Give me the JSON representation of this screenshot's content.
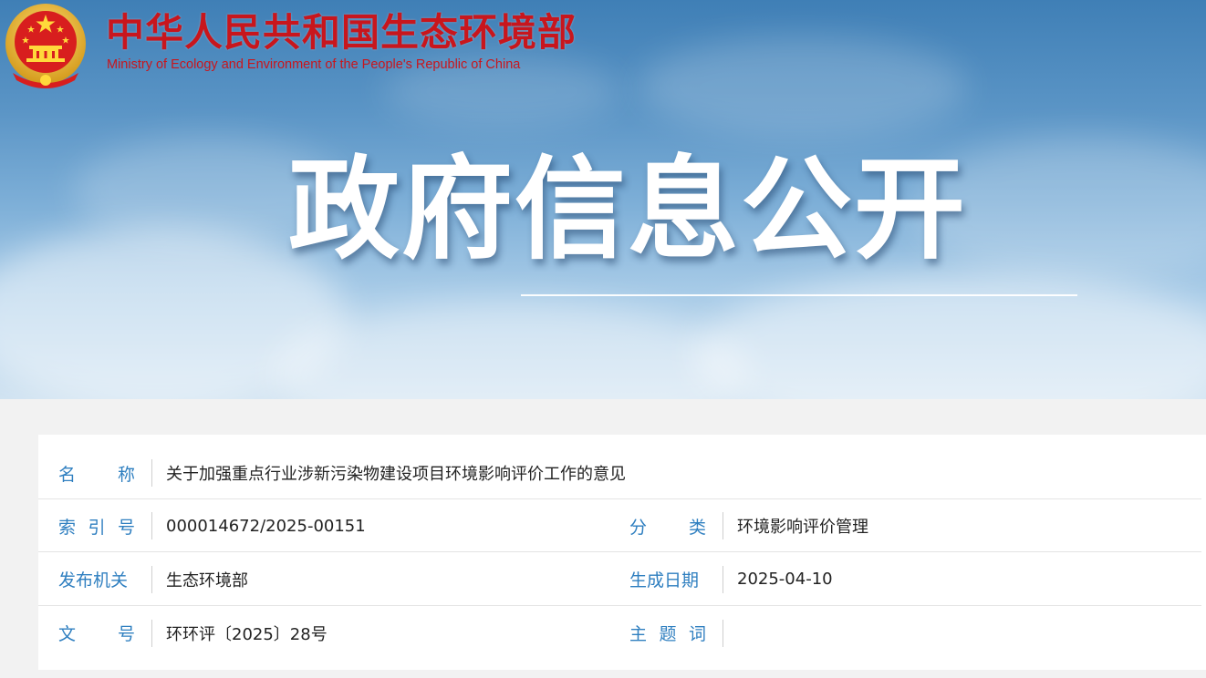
{
  "header": {
    "site_name_cn": "中华人民共和国生态环境部",
    "site_name_en": "Ministry of Ecology and Environment of the People's Republic of China",
    "banner_title": "政府信息公开"
  },
  "colors": {
    "brand_red": "#c8161d",
    "label_blue": "#2f7fc0",
    "sky_blue": "#4f8cc2"
  },
  "info": {
    "name_label": [
      "名",
      "称"
    ],
    "name_value": "关于加强重点行业涉新污染物建设项目环境影响评价工作的意见",
    "index_label": [
      "索",
      "引",
      "号"
    ],
    "index_value": "000014672/2025-00151",
    "category_label": [
      "分",
      "类"
    ],
    "category_value": "环境影响评价管理",
    "publisher_label": [
      "发布机关"
    ],
    "publisher_value": "生态环境部",
    "date_label": [
      "生成日期"
    ],
    "date_value": "2025-04-10",
    "docno_label": [
      "文",
      "号"
    ],
    "docno_value": "环环评〔2025〕28号",
    "keywords_label": [
      "主",
      "题",
      "词"
    ],
    "keywords_value": ""
  }
}
